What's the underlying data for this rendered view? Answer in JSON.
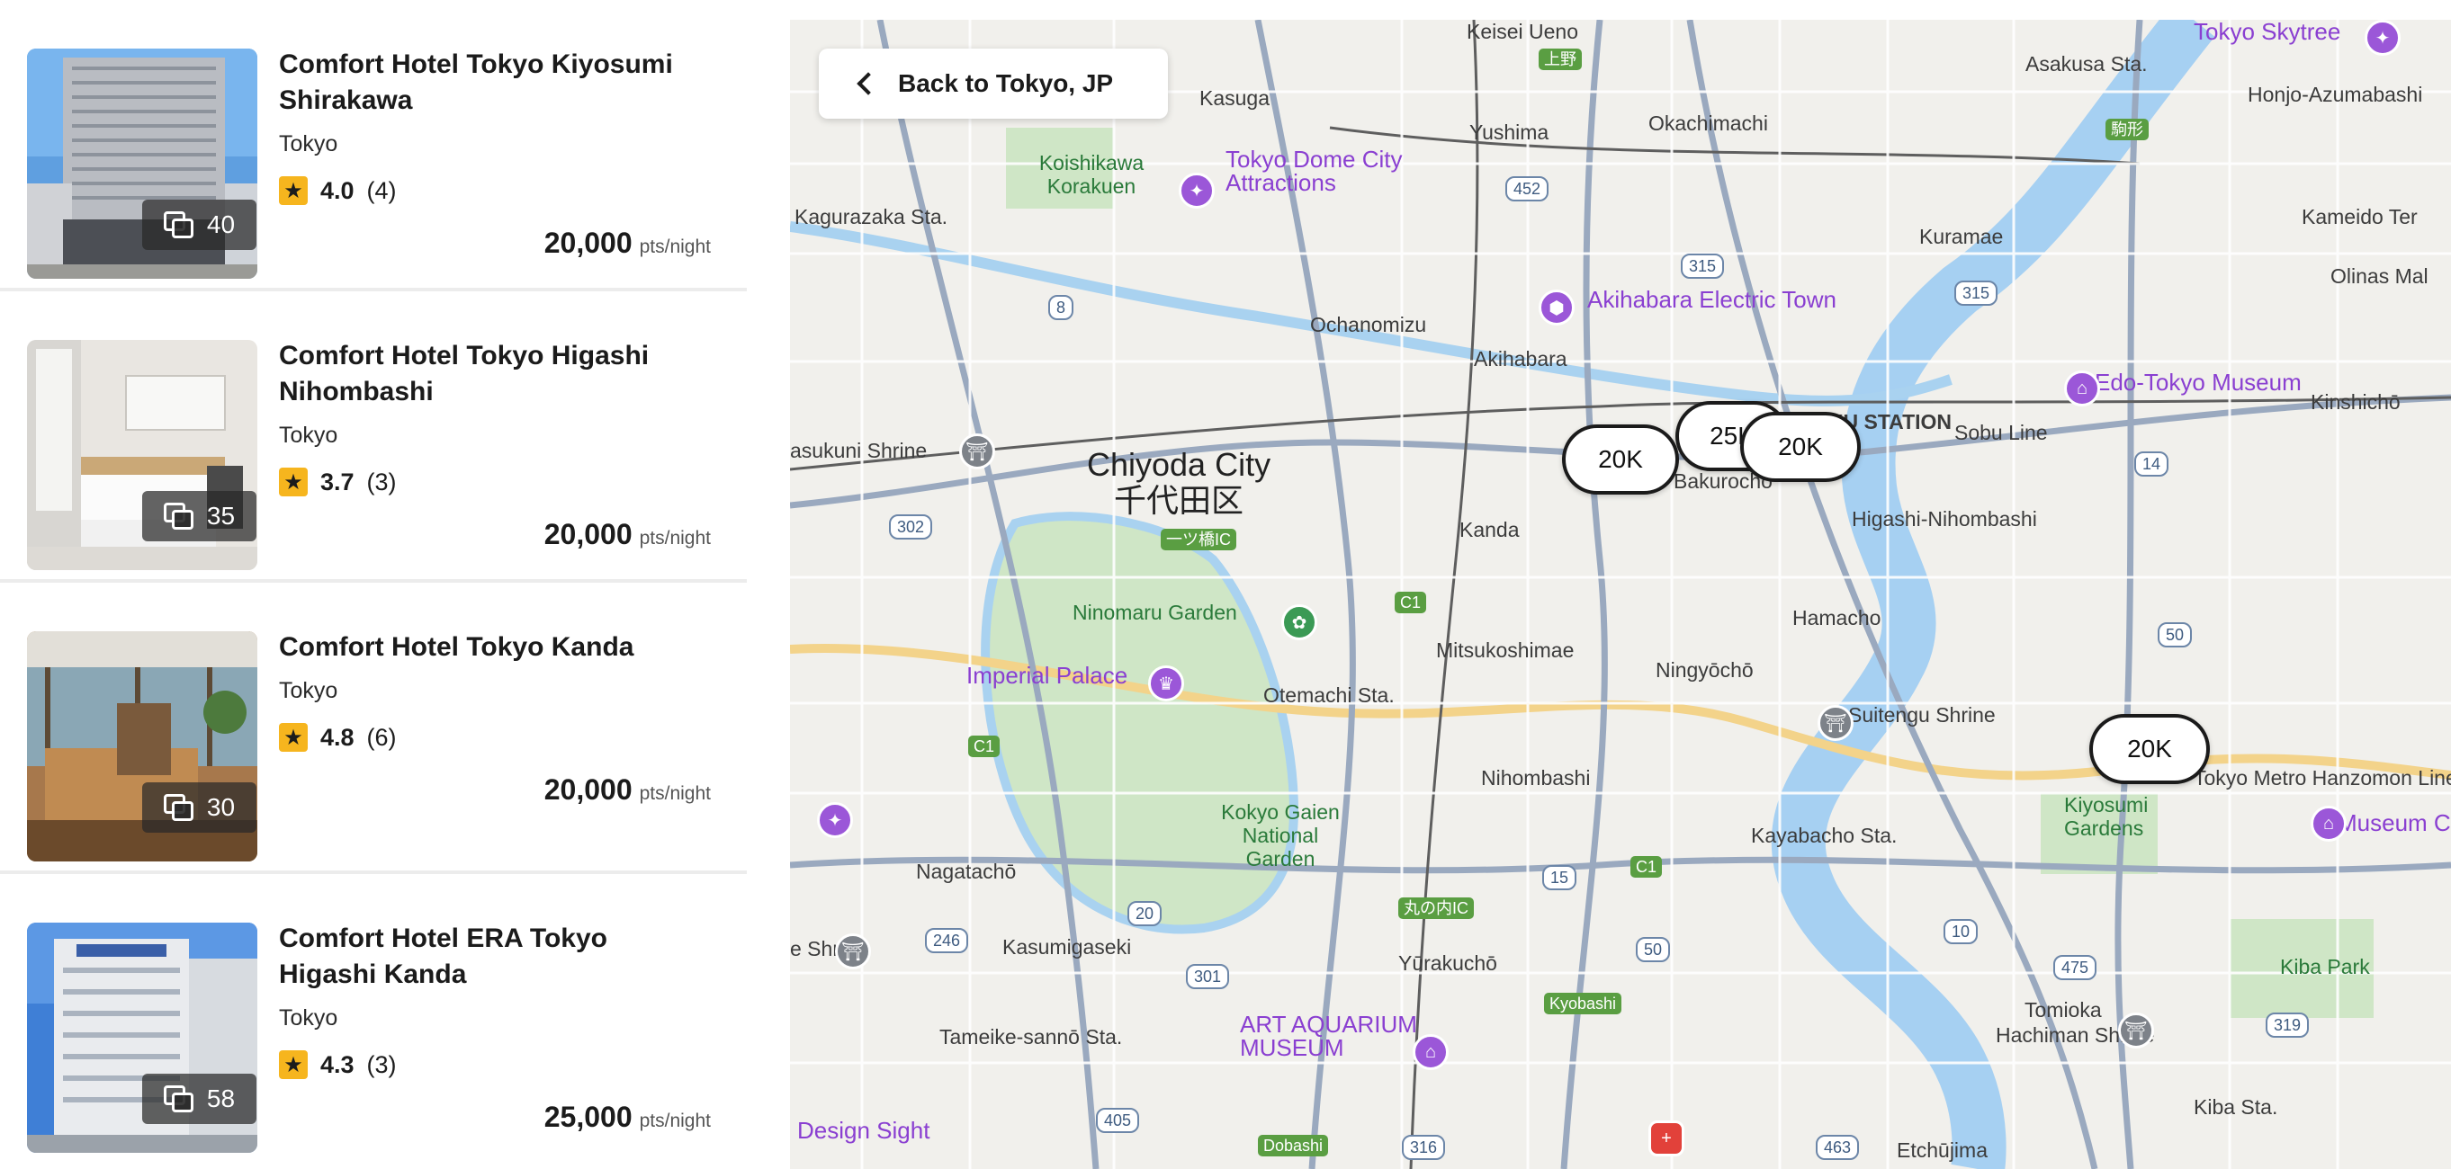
{
  "hotels": [
    {
      "name": "Comfort Hotel Tokyo Kiyosumi Shirakawa",
      "city": "Tokyo",
      "rating": "4.0",
      "reviews": "(4)",
      "photos": "40",
      "price": "20,000",
      "unit": "pts/night"
    },
    {
      "name": "Comfort Hotel Tokyo Higashi Nihombashi",
      "city": "Tokyo",
      "rating": "3.7",
      "reviews": "(3)",
      "photos": "35",
      "price": "20,000",
      "unit": "pts/night"
    },
    {
      "name": "Comfort Hotel Tokyo Kanda",
      "city": "Tokyo",
      "rating": "4.8",
      "reviews": "(6)",
      "photos": "30",
      "price": "20,000",
      "unit": "pts/night"
    },
    {
      "name": "Comfort Hotel ERA Tokyo Higashi Kanda",
      "city": "Tokyo",
      "rating": "4.3",
      "reviews": "(3)",
      "photos": "58",
      "price": "25,000",
      "unit": "pts/night"
    }
  ],
  "map": {
    "back_label": "Back to Tokyo, JP",
    "pins": [
      "20K",
      "25K",
      "20K",
      "20K"
    ],
    "labels": {
      "chiyoda": "Chiyoda City",
      "chiyoda_jp": "千代田区",
      "kasuga": "Kasuga",
      "yushima": "Yushima",
      "okachimachi": "Okachimachi",
      "asakusa": "Asakusa Sta.",
      "kuramae": "Kuramae",
      "kagurazaka": "Kagurazaka Sta.",
      "ochanomizu": "Ochanomizu",
      "akihabara": "Akihabara",
      "akihabara_town": "Akihabara Electric Town",
      "tokyo_dome": "Tokyo Dome City Attractions",
      "koishikawa": "Koishikawa Korakuen",
      "kanda": "Kanda",
      "bakurocho": "Bakurochō",
      "higashi_nihombashi": "Higashi-Nihombashi",
      "ryogoku": "OKU STATION",
      "sobu": "Sobu Line",
      "edo_museum": "Edo-Tokyo Museum",
      "kinshicho": "Kinshichō",
      "ninomaru": "Ninomaru Garden",
      "imperial": "Imperial Palace",
      "otemachi": "Otemachi Sta.",
      "mitsukoshimae": "Mitsukoshimae",
      "ningyocho": "Ningyōchō",
      "hamacho": "Hamacho",
      "suitengu": "Suitengu Shrine",
      "nihombashi": "Nihombashi",
      "kokyo_gaien": "Kokyo Gaien National Garden",
      "kayabacho": "Kayabacho Sta.",
      "kiyosumi": "Kiyosumi Gardens",
      "hanzomon": "Tokyo Metro Hanzomon Line",
      "nagatacho": "Nagatachō",
      "kasumigaseki": "Kasumigaseki",
      "tameike": "Tameike-sannō Sta.",
      "yurakucho": "Yūrakuchō",
      "art_aquarium": "ART AQUARIUM MUSEUM",
      "kyobashi": "Kyobashi",
      "hachiman": "Hachiman Shrine",
      "tomioka": "Tomioka",
      "kiba_park": "Kiba Park",
      "kiba_sta": "Kiba Sta.",
      "etchujima": "Etchūjima",
      "design_sight": "Design Sight",
      "skytree": "Tokyo Skytree",
      "honjo": "Honjo-Azumabashi",
      "kameido": "Kameido Ter",
      "olinas": "Olinas Mal",
      "keisei_ueno": "Keisei Ueno",
      "yasukuni": "asukuni Shrine",
      "museum_ct": "Museum Contemp",
      "hie": "e Shrine",
      "dobashi": "Dobashi"
    }
  }
}
